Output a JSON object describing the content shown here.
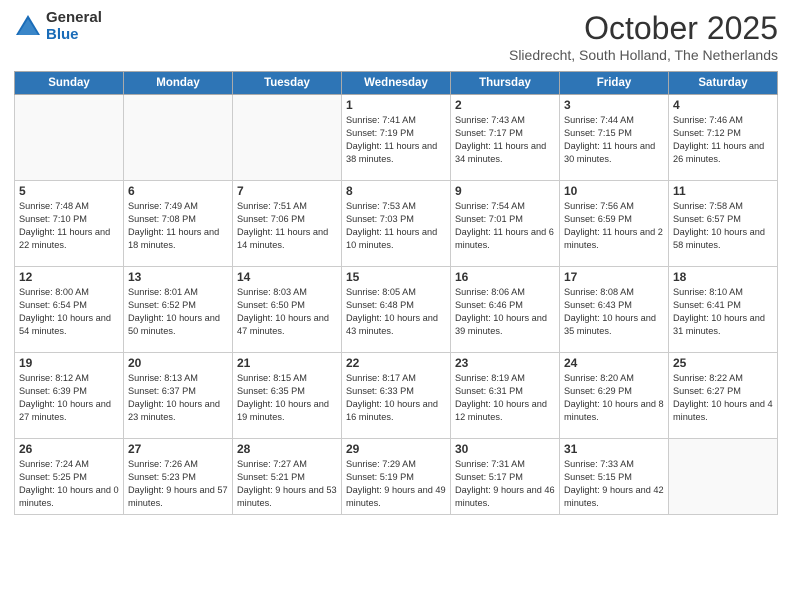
{
  "logo": {
    "general": "General",
    "blue": "Blue"
  },
  "title": "October 2025",
  "subtitle": "Sliedrecht, South Holland, The Netherlands",
  "days_of_week": [
    "Sunday",
    "Monday",
    "Tuesday",
    "Wednesday",
    "Thursday",
    "Friday",
    "Saturday"
  ],
  "weeks": [
    [
      {
        "day": "",
        "info": ""
      },
      {
        "day": "",
        "info": ""
      },
      {
        "day": "",
        "info": ""
      },
      {
        "day": "1",
        "info": "Sunrise: 7:41 AM\nSunset: 7:19 PM\nDaylight: 11 hours and 38 minutes."
      },
      {
        "day": "2",
        "info": "Sunrise: 7:43 AM\nSunset: 7:17 PM\nDaylight: 11 hours and 34 minutes."
      },
      {
        "day": "3",
        "info": "Sunrise: 7:44 AM\nSunset: 7:15 PM\nDaylight: 11 hours and 30 minutes."
      },
      {
        "day": "4",
        "info": "Sunrise: 7:46 AM\nSunset: 7:12 PM\nDaylight: 11 hours and 26 minutes."
      }
    ],
    [
      {
        "day": "5",
        "info": "Sunrise: 7:48 AM\nSunset: 7:10 PM\nDaylight: 11 hours and 22 minutes."
      },
      {
        "day": "6",
        "info": "Sunrise: 7:49 AM\nSunset: 7:08 PM\nDaylight: 11 hours and 18 minutes."
      },
      {
        "day": "7",
        "info": "Sunrise: 7:51 AM\nSunset: 7:06 PM\nDaylight: 11 hours and 14 minutes."
      },
      {
        "day": "8",
        "info": "Sunrise: 7:53 AM\nSunset: 7:03 PM\nDaylight: 11 hours and 10 minutes."
      },
      {
        "day": "9",
        "info": "Sunrise: 7:54 AM\nSunset: 7:01 PM\nDaylight: 11 hours and 6 minutes."
      },
      {
        "day": "10",
        "info": "Sunrise: 7:56 AM\nSunset: 6:59 PM\nDaylight: 11 hours and 2 minutes."
      },
      {
        "day": "11",
        "info": "Sunrise: 7:58 AM\nSunset: 6:57 PM\nDaylight: 10 hours and 58 minutes."
      }
    ],
    [
      {
        "day": "12",
        "info": "Sunrise: 8:00 AM\nSunset: 6:54 PM\nDaylight: 10 hours and 54 minutes."
      },
      {
        "day": "13",
        "info": "Sunrise: 8:01 AM\nSunset: 6:52 PM\nDaylight: 10 hours and 50 minutes."
      },
      {
        "day": "14",
        "info": "Sunrise: 8:03 AM\nSunset: 6:50 PM\nDaylight: 10 hours and 47 minutes."
      },
      {
        "day": "15",
        "info": "Sunrise: 8:05 AM\nSunset: 6:48 PM\nDaylight: 10 hours and 43 minutes."
      },
      {
        "day": "16",
        "info": "Sunrise: 8:06 AM\nSunset: 6:46 PM\nDaylight: 10 hours and 39 minutes."
      },
      {
        "day": "17",
        "info": "Sunrise: 8:08 AM\nSunset: 6:43 PM\nDaylight: 10 hours and 35 minutes."
      },
      {
        "day": "18",
        "info": "Sunrise: 8:10 AM\nSunset: 6:41 PM\nDaylight: 10 hours and 31 minutes."
      }
    ],
    [
      {
        "day": "19",
        "info": "Sunrise: 8:12 AM\nSunset: 6:39 PM\nDaylight: 10 hours and 27 minutes."
      },
      {
        "day": "20",
        "info": "Sunrise: 8:13 AM\nSunset: 6:37 PM\nDaylight: 10 hours and 23 minutes."
      },
      {
        "day": "21",
        "info": "Sunrise: 8:15 AM\nSunset: 6:35 PM\nDaylight: 10 hours and 19 minutes."
      },
      {
        "day": "22",
        "info": "Sunrise: 8:17 AM\nSunset: 6:33 PM\nDaylight: 10 hours and 16 minutes."
      },
      {
        "day": "23",
        "info": "Sunrise: 8:19 AM\nSunset: 6:31 PM\nDaylight: 10 hours and 12 minutes."
      },
      {
        "day": "24",
        "info": "Sunrise: 8:20 AM\nSunset: 6:29 PM\nDaylight: 10 hours and 8 minutes."
      },
      {
        "day": "25",
        "info": "Sunrise: 8:22 AM\nSunset: 6:27 PM\nDaylight: 10 hours and 4 minutes."
      }
    ],
    [
      {
        "day": "26",
        "info": "Sunrise: 7:24 AM\nSunset: 5:25 PM\nDaylight: 10 hours and 0 minutes."
      },
      {
        "day": "27",
        "info": "Sunrise: 7:26 AM\nSunset: 5:23 PM\nDaylight: 9 hours and 57 minutes."
      },
      {
        "day": "28",
        "info": "Sunrise: 7:27 AM\nSunset: 5:21 PM\nDaylight: 9 hours and 53 minutes."
      },
      {
        "day": "29",
        "info": "Sunrise: 7:29 AM\nSunset: 5:19 PM\nDaylight: 9 hours and 49 minutes."
      },
      {
        "day": "30",
        "info": "Sunrise: 7:31 AM\nSunset: 5:17 PM\nDaylight: 9 hours and 46 minutes."
      },
      {
        "day": "31",
        "info": "Sunrise: 7:33 AM\nSunset: 5:15 PM\nDaylight: 9 hours and 42 minutes."
      },
      {
        "day": "",
        "info": ""
      }
    ]
  ]
}
